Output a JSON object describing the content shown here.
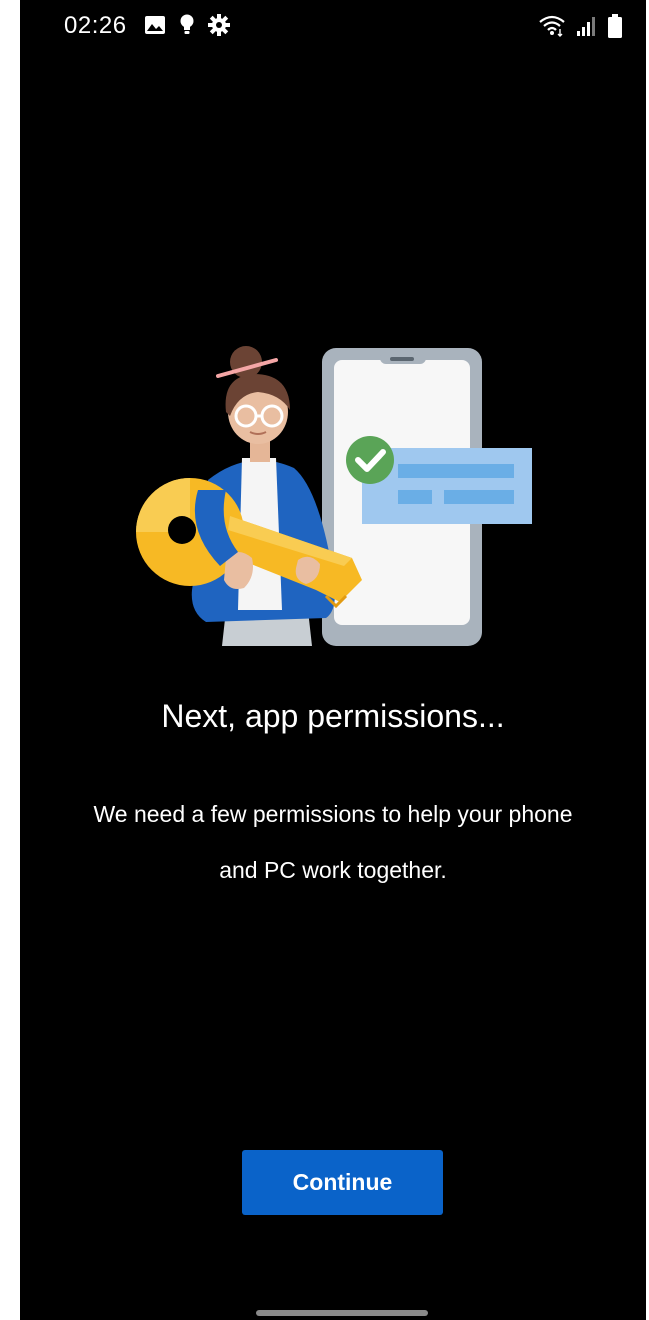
{
  "status_bar": {
    "time": "02:26",
    "left_icons": [
      "image-icon",
      "lightbulb-icon",
      "gear-icon"
    ],
    "right_icons": [
      "wifi-icon",
      "signal-icon",
      "battery-icon"
    ]
  },
  "onboarding": {
    "title": "Next, app permissions...",
    "description": "We need a few permissions to help your phone and PC work together.",
    "continue_label": "Continue"
  },
  "colors": {
    "background": "#000000",
    "button": "#0a63c9",
    "text": "#ffffff"
  }
}
